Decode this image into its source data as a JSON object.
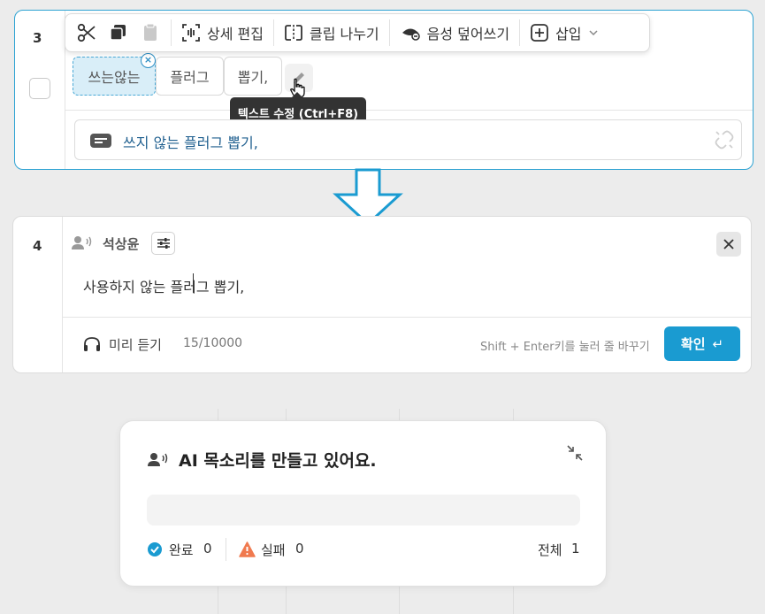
{
  "row3": {
    "number": "3",
    "toolbar": {
      "cut_icon": "scissors-icon",
      "copy_icon": "copy-icon",
      "paste_icon": "clipboard-icon",
      "detail_edit_label": "상세 편집",
      "split_clip_label": "클립 나누기",
      "voice_overwrite_label": "음성 덮어쓰기",
      "insert_label": "삽입"
    },
    "chips": [
      "쓰는않는",
      "플러그",
      "뽑기,"
    ],
    "tooltip": "텍스트 수정 (Ctrl+F8)",
    "text_field": "쓰지 않는 플러그 뽑기,"
  },
  "row4": {
    "number": "4",
    "speaker_name": "석상윤",
    "script_text": "사용하지 않는 플러그 뽑기,",
    "preview_label": "미리 듣기",
    "char_count": "15/10000",
    "hint": "Shift + Enter키를 눌러 줄 바꾸기",
    "confirm_label": "확인",
    "enter_glyph": "↵"
  },
  "panel": {
    "title": "AI 목소리를 만들고 있어요.",
    "progress_fraction": 0.0,
    "complete_label": "완료",
    "complete_count": "0",
    "fail_label": "실패",
    "fail_count": "0",
    "total_label": "전체",
    "total_count": "1"
  },
  "colors": {
    "accent": "#1a9bd1",
    "selected_border": "#2ea3d3",
    "fail": "#f07a4f"
  }
}
